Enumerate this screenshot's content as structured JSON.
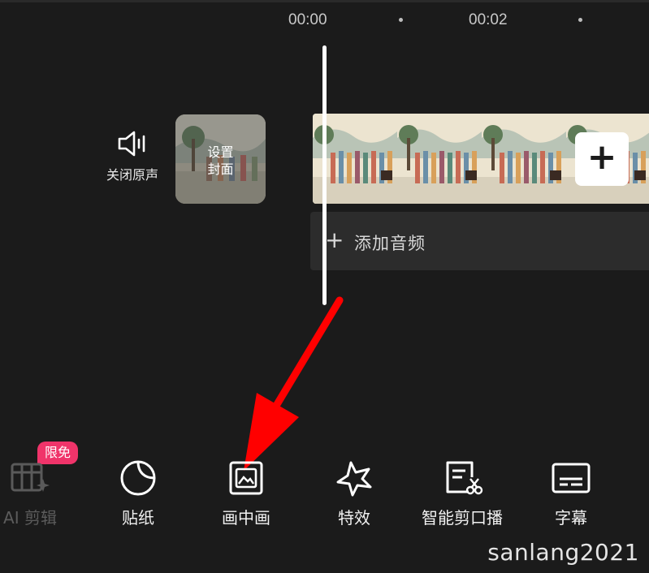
{
  "timeline": {
    "time_marks": [
      "00:00",
      "00:02"
    ]
  },
  "mute": {
    "label": "关闭原声",
    "icon": "speaker-icon"
  },
  "cover": {
    "label": "设置\n封面"
  },
  "clip": {
    "add_icon": "plus-icon"
  },
  "audio": {
    "label": "添加音频",
    "icon": "plus-icon"
  },
  "toolbar": {
    "badge": "限免",
    "items": [
      {
        "label": "AI 剪辑",
        "icon": "ai-edit-icon",
        "enabled": false
      },
      {
        "label": "贴纸",
        "icon": "sticker-icon",
        "enabled": true
      },
      {
        "label": "画中画",
        "icon": "picture-in-picture-icon",
        "enabled": true
      },
      {
        "label": "特效",
        "icon": "effects-star-icon",
        "enabled": true
      },
      {
        "label": "智能剪口播",
        "icon": "smart-cut-icon",
        "enabled": true
      },
      {
        "label": "字幕",
        "icon": "subtitle-icon",
        "enabled": true
      }
    ]
  },
  "watermark": "sanlang2021",
  "colors": {
    "background": "#1b1b1b",
    "badge": "#f0346a",
    "annotation_arrow": "#ff0000"
  }
}
